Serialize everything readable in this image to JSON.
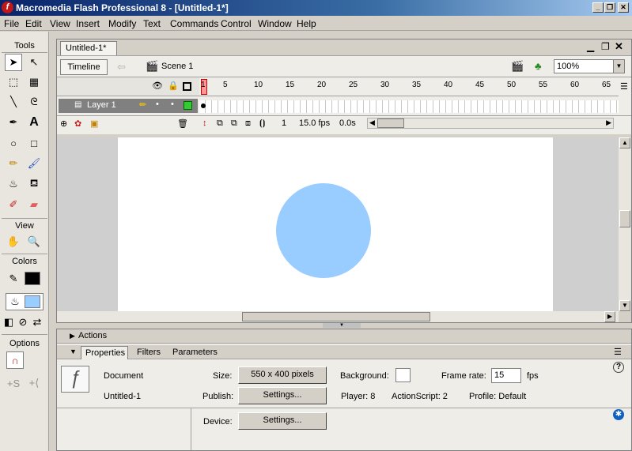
{
  "window": {
    "title": "Macromedia Flash Professional 8 - [Untitled-1*]",
    "minimize": "_",
    "restore": "❐",
    "close": "✕"
  },
  "menu": [
    "File",
    "Edit",
    "View",
    "Insert",
    "Modify",
    "Text",
    "Commands",
    "Control",
    "Window",
    "Help"
  ],
  "tools": {
    "header": "Tools",
    "view_label": "View",
    "colors_label": "Colors",
    "options_label": "Options"
  },
  "document": {
    "tab": "Untitled-1*",
    "timeline_button": "Timeline",
    "scene": "Scene 1",
    "zoom": "100%"
  },
  "timeline": {
    "layer_name": "Layer 1",
    "ruler": [
      "1",
      "5",
      "10",
      "15",
      "20",
      "25",
      "30",
      "35",
      "40",
      "45",
      "50",
      "55",
      "60",
      "65"
    ],
    "current_frame": "1",
    "fps": "15.0 fps",
    "time": "0.0s"
  },
  "panels": {
    "actions": "Actions",
    "tabs": [
      "Properties",
      "Filters",
      "Parameters"
    ]
  },
  "properties": {
    "doc_type": "Document",
    "doc_name": "Untitled-1",
    "size_label": "Size:",
    "size_value": "550 x 400 pixels",
    "background_label": "Background:",
    "frame_rate_label": "Frame rate:",
    "frame_rate_value": "15",
    "fps_unit": "fps",
    "publish_label": "Publish:",
    "settings_button": "Settings...",
    "player": "Player: 8",
    "actionscript": "ActionScript:  2",
    "profile": "Profile:  Default",
    "device_label": "Device:",
    "device_settings_button": "Settings..."
  },
  "colors": {
    "circle_fill": "#99ccff",
    "stage": "#ffffff",
    "title_gradient_start": "#0a246a"
  }
}
